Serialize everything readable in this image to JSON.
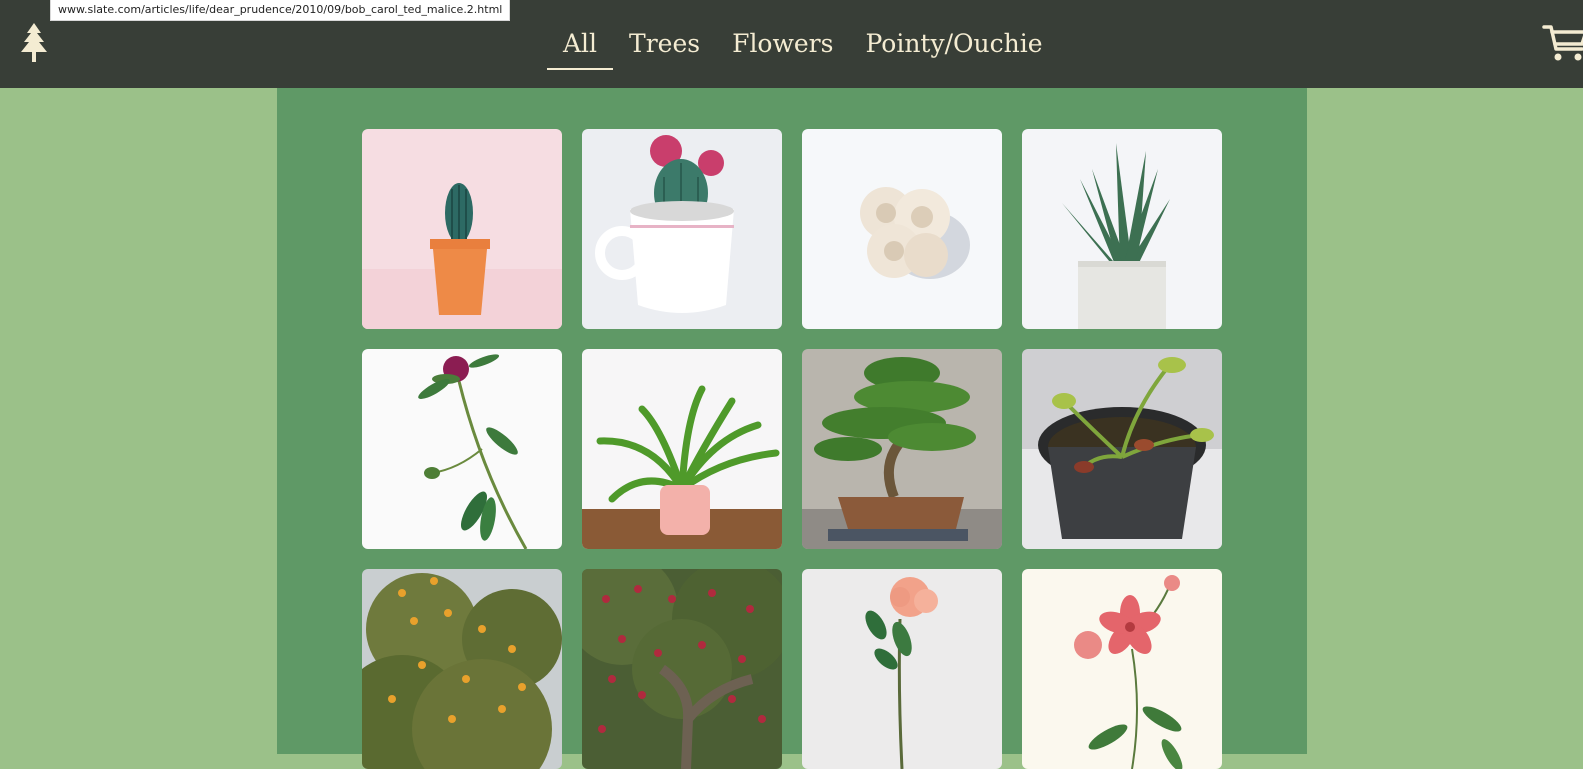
{
  "tooltip": {
    "url": "www.slate.com/articles/life/dear_prudence/2010/09/bob_carol_ted_malice.2.html"
  },
  "header": {
    "logo_icon": "pine-tree-icon",
    "cart_icon": "shopping-cart-icon",
    "nav": [
      {
        "label": "All",
        "active": true
      },
      {
        "label": "Trees",
        "active": false
      },
      {
        "label": "Flowers",
        "active": false
      },
      {
        "label": "Pointy/Ouchie",
        "active": false
      }
    ]
  },
  "colors": {
    "header_bg": "#383e37",
    "page_bg": "#9bc189",
    "content_bg": "#5f9966",
    "nav_text": "#f4ecd2"
  },
  "products": [
    {
      "subject": "cactus in orange pot"
    },
    {
      "subject": "flowering cactus in white cup"
    },
    {
      "subject": "white roses"
    },
    {
      "subject": "aloe in white pot"
    },
    {
      "subject": "peony stem"
    },
    {
      "subject": "fern in pink pot"
    },
    {
      "subject": "bonsai tree"
    },
    {
      "subject": "venus flytrap"
    },
    {
      "subject": "orange tree"
    },
    {
      "subject": "apple tree"
    },
    {
      "subject": "peach rose"
    },
    {
      "subject": "botanical flower illustration"
    }
  ]
}
